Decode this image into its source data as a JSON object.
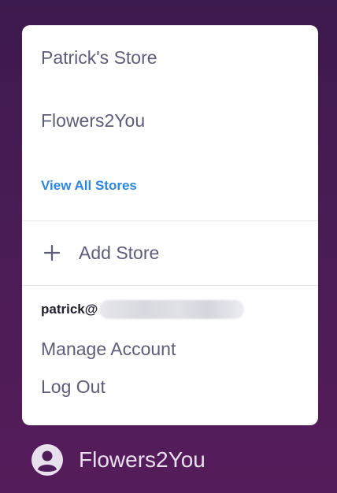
{
  "menu": {
    "stores": [
      "Patrick's Store",
      "Flowers2You"
    ],
    "view_all_label": "View All Stores",
    "add_store_label": "Add Store",
    "account_email": "patrick@",
    "manage_account_label": "Manage Account",
    "log_out_label": "Log Out"
  },
  "footer": {
    "current_store": "Flowers2You"
  },
  "colors": {
    "background": "#4a1c55",
    "link": "#2d86df",
    "menu_text": "#5d5d7a"
  },
  "icons": {
    "add": "plus-icon",
    "user": "user-circle-icon"
  }
}
